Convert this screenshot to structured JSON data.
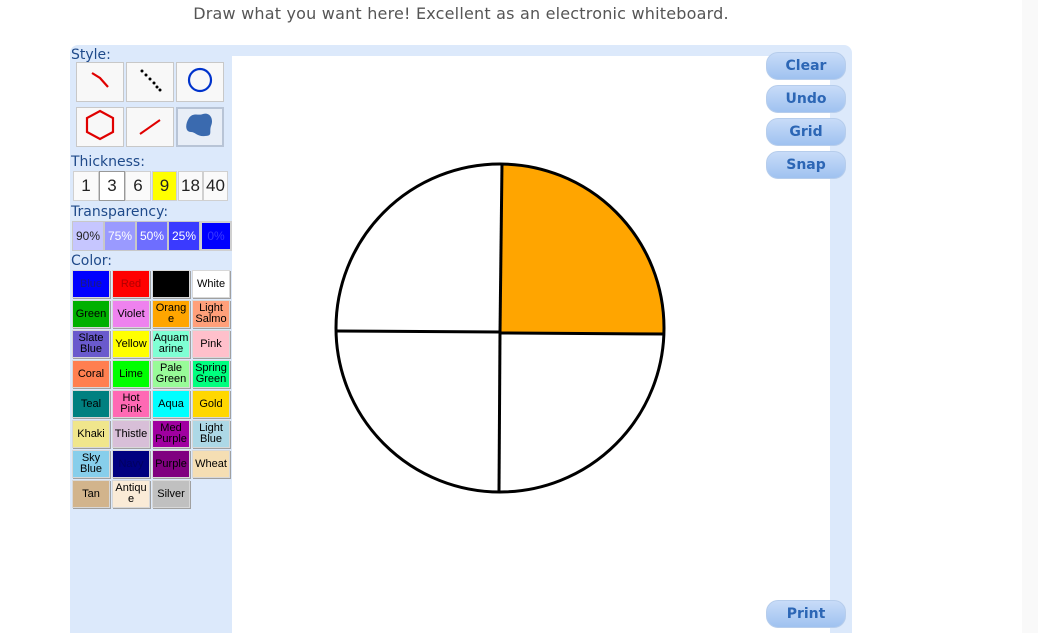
{
  "header": {
    "text": "Draw what you want here! Excellent as an electronic whiteboard."
  },
  "labels": {
    "style": "Style:",
    "thickness": "Thickness:",
    "transparency": "Transparency:",
    "color": "Color:"
  },
  "style_tools": [
    {
      "name": "freehand-tool",
      "icon": "freehand-line-icon",
      "selected": false
    },
    {
      "name": "dotted-tool",
      "icon": "dotted-line-icon",
      "selected": false
    },
    {
      "name": "circle-tool",
      "icon": "circle-icon",
      "selected": false
    },
    {
      "name": "polygon-tool",
      "icon": "hexagon-icon",
      "selected": false
    },
    {
      "name": "line-tool",
      "icon": "straight-line-icon",
      "selected": false
    },
    {
      "name": "fill-tool",
      "icon": "fill-blob-icon",
      "selected": true
    }
  ],
  "thickness": {
    "options": [
      "1",
      "3",
      "6",
      "9",
      "18",
      "40"
    ],
    "selected": "9",
    "highlight_color": "#ffff00"
  },
  "transparency": {
    "options": [
      "90%",
      "75%",
      "50%",
      "25%",
      "0%"
    ],
    "colors": [
      "#c6c6ff",
      "#9a9aff",
      "#6e6eff",
      "#3a3aff",
      "#0000ff"
    ]
  },
  "colors": [
    {
      "label": "Blue",
      "hex": "#0000ff",
      "text": "#1a1a80"
    },
    {
      "label": "Red",
      "hex": "#ff0000",
      "text": "#b00000"
    },
    {
      "label": "Black",
      "hex": "#000000",
      "text": "#000000"
    },
    {
      "label": "White",
      "hex": "#ffffff",
      "text": "#000000"
    },
    {
      "label": "Green",
      "hex": "#00b000",
      "text": "#000000"
    },
    {
      "label": "Violet",
      "hex": "#ee82ee",
      "text": "#000000"
    },
    {
      "label": "Orange",
      "hex": "#ffa500",
      "text": "#000000"
    },
    {
      "label": "Light Salmon",
      "hex": "#ffa07a",
      "text": "#000000"
    },
    {
      "label": "Slate Blue",
      "hex": "#6a5acd",
      "text": "#000000"
    },
    {
      "label": "Yellow",
      "hex": "#ffff00",
      "text": "#000000"
    },
    {
      "label": "Aquamarine",
      "hex": "#7fffd4",
      "text": "#000000"
    },
    {
      "label": "Pink",
      "hex": "#ffc0cb",
      "text": "#000000"
    },
    {
      "label": "Coral",
      "hex": "#ff7f50",
      "text": "#000000"
    },
    {
      "label": "Lime",
      "hex": "#00ff00",
      "text": "#000000"
    },
    {
      "label": "Pale Green",
      "hex": "#98fb98",
      "text": "#000000"
    },
    {
      "label": "Spring Green",
      "hex": "#00ff7f",
      "text": "#000000"
    },
    {
      "label": "Teal",
      "hex": "#008080",
      "text": "#000000"
    },
    {
      "label": "Hot Pink",
      "hex": "#ff69b4",
      "text": "#000000"
    },
    {
      "label": "Aqua",
      "hex": "#00ffff",
      "text": "#000000"
    },
    {
      "label": "Gold",
      "hex": "#ffd700",
      "text": "#000000"
    },
    {
      "label": "Khaki",
      "hex": "#f0e68c",
      "text": "#000000"
    },
    {
      "label": "Thistle",
      "hex": "#d8bfd8",
      "text": "#000000"
    },
    {
      "label": "Med Purple",
      "hex": "#a000a0",
      "text": "#000000"
    },
    {
      "label": "Light Blue",
      "hex": "#add8e6",
      "text": "#000000"
    },
    {
      "label": "Sky Blue",
      "hex": "#87ceeb",
      "text": "#000000"
    },
    {
      "label": "Navy",
      "hex": "#000080",
      "text": "#000060"
    },
    {
      "label": "Purple",
      "hex": "#800080",
      "text": "#000000"
    },
    {
      "label": "Wheat",
      "hex": "#f5deb3",
      "text": "#000000"
    },
    {
      "label": "Tan",
      "hex": "#d2b48c",
      "text": "#000000"
    },
    {
      "label": "Antique",
      "hex": "#faebd7",
      "text": "#000000"
    },
    {
      "label": "Silver",
      "hex": "#c0c0c0",
      "text": "#000000"
    }
  ],
  "color_labels_display": {
    "Orange": "Orang e",
    "Antique": "Antiqu e",
    "Light Salmon": "Light Salmo",
    "Aquamarine": "Aquam arine"
  },
  "buttons": {
    "clear": "Clear",
    "undo": "Undo",
    "grid": "Grid",
    "snap": "Snap",
    "print": "Print"
  },
  "drawing": {
    "description_colors": {
      "fill": "#ffa500",
      "stroke": "#000000"
    },
    "filled_quadrant": "top-right"
  }
}
